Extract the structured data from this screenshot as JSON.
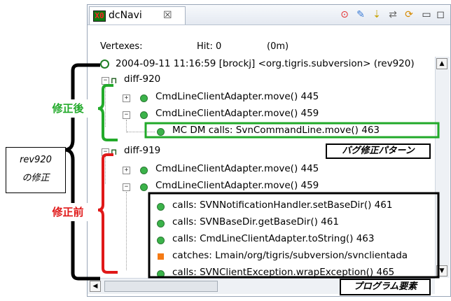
{
  "view": {
    "title": "dcNavi",
    "app_icon_text": "X0",
    "close_glyph": "☒",
    "toolbar": [
      {
        "name": "record-icon",
        "glyph": "⊙",
        "color": "#e23030"
      },
      {
        "name": "edit-icon",
        "glyph": "✎",
        "color": "#3a7bd5"
      },
      {
        "name": "arrows-down-icon",
        "glyph": "⇣",
        "color": "#c7a200"
      },
      {
        "name": "arrows-horizontal-icon",
        "glyph": "⇄",
        "color": "#6a6a6a"
      },
      {
        "name": "refresh-icon",
        "glyph": "⟳",
        "color": "#d58a00"
      },
      {
        "name": "minimize-icon",
        "glyph": "▭",
        "color": "#333333"
      },
      {
        "name": "maximize-icon",
        "glyph": "◻",
        "color": "#333333"
      }
    ]
  },
  "status": {
    "vertexes_label": "Vertexes:",
    "hit_label": "Hit: 0",
    "time_label": "(0m)"
  },
  "tree": {
    "root": "2004-09-11 11:16:59 [brockj] <org.tigris.subversion> (rev920)",
    "diff920": "diff-920",
    "d920_r1": "CmdLineClientAdapter.move() 445",
    "d920_r2": "CmdLineClientAdapter.move() 459",
    "d920_r3": "MC DM calls: SvnCommandLine.move() 463",
    "diff919": "diff-919",
    "d919_r1": "CmdLineClientAdapter.move() 445",
    "d919_r2": "CmdLineClientAdapter.move() 459",
    "c1": "calls: SVNNotificationHandler.setBaseDir() 461",
    "c2": "calls: SVNBaseDir.getBaseDir() 461",
    "c3": "calls: CmdLineClientAdapter.toString() 463",
    "c4": "catches: Lmain/org/tigris/subversion/svnclientada",
    "c5": "calls: SVNClientException.wrapException() 465"
  },
  "annotations": {
    "after_fix": "修正後",
    "before_fix": "修正前",
    "rev_fix_line1": "rev920",
    "rev_fix_line2": "の修正",
    "bug_fix_pattern": "バグ修正パターン",
    "program_element": "プログラム要素"
  },
  "colors": {
    "green": "#22aa2a",
    "red": "#e01818",
    "black": "#000000",
    "node_green": "#3bb34a",
    "node_orange": "#f57a14"
  }
}
